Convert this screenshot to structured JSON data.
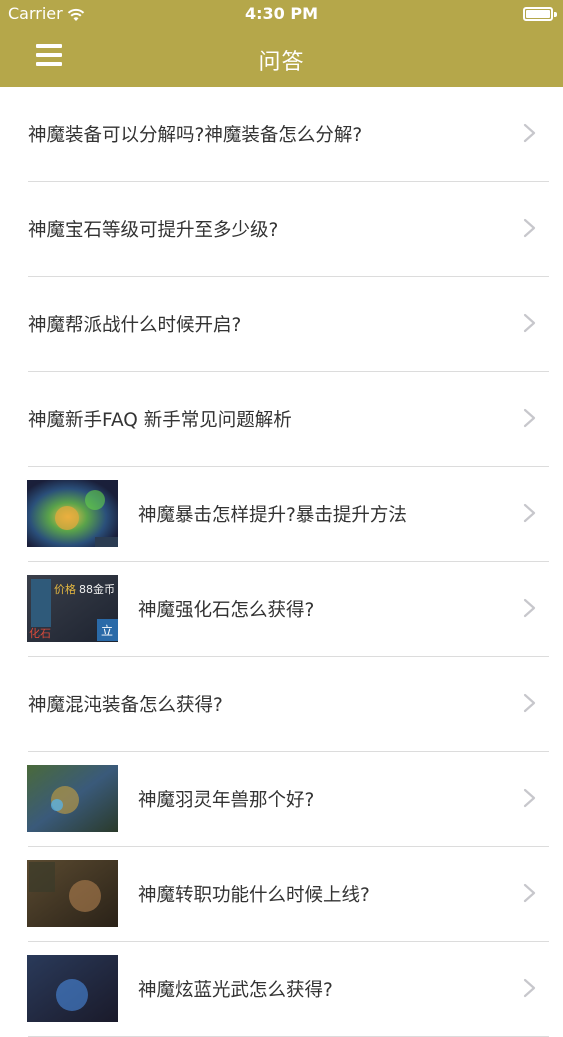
{
  "statusbar": {
    "carrier": "Carrier",
    "time": "4:30 PM"
  },
  "navbar": {
    "title": "问答"
  },
  "colors": {
    "header_bg": "#b5a74a",
    "text": "#333333",
    "separator": "#dcdcdc",
    "chevron": "#c7c7cc"
  },
  "items": [
    {
      "title": "神魔装备可以分解吗?神魔装备怎么分解?",
      "thumb": false
    },
    {
      "title": "神魔宝石等级可提升至多少级?",
      "thumb": false
    },
    {
      "title": "神魔帮派战什么时候开启?",
      "thumb": false
    },
    {
      "title": "神魔新手FAQ 新手常见问题解析",
      "thumb": false
    },
    {
      "title": "神魔暴击怎样提升?暴击提升方法",
      "thumb": true
    },
    {
      "title": "神魔强化石怎么获得?",
      "thumb": true,
      "thumb_label_1": "价格",
      "thumb_label_2": "88金币",
      "thumb_label_3": "化石",
      "thumb_label_4": "立"
    },
    {
      "title": "神魔混沌装备怎么获得?",
      "thumb": false
    },
    {
      "title": "神魔羽灵年兽那个好?",
      "thumb": true
    },
    {
      "title": "神魔转职功能什么时候上线?",
      "thumb": true
    },
    {
      "title": "神魔炫蓝光武怎么获得?",
      "thumb": true
    }
  ]
}
